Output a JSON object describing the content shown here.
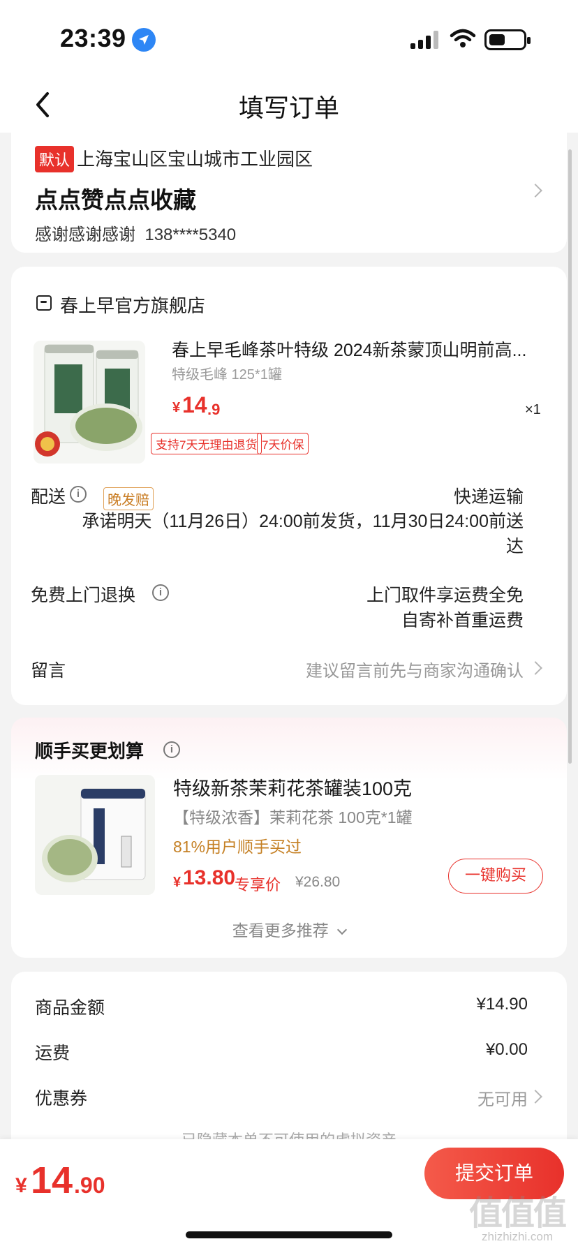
{
  "status_bar": {
    "time": "23:39"
  },
  "nav": {
    "title": "填写订单"
  },
  "address": {
    "default_tag": "默认",
    "line": "上海宝山区宝山城市工业园区",
    "name": "点点赞点点收藏",
    "contact_name": "感谢感谢感谢",
    "phone": "138****5340"
  },
  "store": {
    "name": "春上早官方旗舰店",
    "product": {
      "title": "春上早毛峰茶叶特级 2024新茶蒙顶山明前高...",
      "spec": "特级毛峰 125*1罐",
      "price_symbol": "¥",
      "price_int": "14",
      "price_dec": ".9",
      "qty": "×1",
      "tags": [
        "支持7天无理由退货",
        "7天价保"
      ]
    },
    "delivery": {
      "label": "配送",
      "badge": "晚发赔",
      "method": "快递运输",
      "promise_line1": "承诺明天（11月26日）24:00前发货，11月30日24:00前送",
      "promise_line2": "达"
    },
    "returns": {
      "label": "免费上门退换",
      "line1": "上门取件享运费全免",
      "line2": "自寄补首重运费"
    },
    "remark": {
      "label": "留言",
      "hint": "建议留言前先与商家沟通确认"
    }
  },
  "recommend": {
    "title": "顺手买更划算",
    "item": {
      "name": "特级新茶茉莉花茶罐装100克",
      "spec": "【特级浓香】茉莉花茶 100克*1罐",
      "social": "81%用户顺手买过",
      "price_symbol": "¥",
      "price": "13.80",
      "price_label": "专享价",
      "original_price": "¥26.80",
      "buy_button": "一键购买"
    },
    "more": "查看更多推荐"
  },
  "summary": {
    "goods_label": "商品金额",
    "goods_value": "¥14.90",
    "shipping_label": "运费",
    "shipping_value": "¥0.00",
    "coupon_label": "优惠券",
    "coupon_value": "无可用",
    "hidden_note": "已隐藏本单不可使用的虚拟资产"
  },
  "bottom": {
    "total_symbol": "¥",
    "total_int": "14",
    "total_dec": ".90",
    "submit": "提交订单",
    "watermark": "值值值",
    "watermark_url": "zhizhizhi.com"
  },
  "colors": {
    "accent": "#e8312b",
    "gold": "#c58024",
    "background": "#f3f3f3"
  }
}
